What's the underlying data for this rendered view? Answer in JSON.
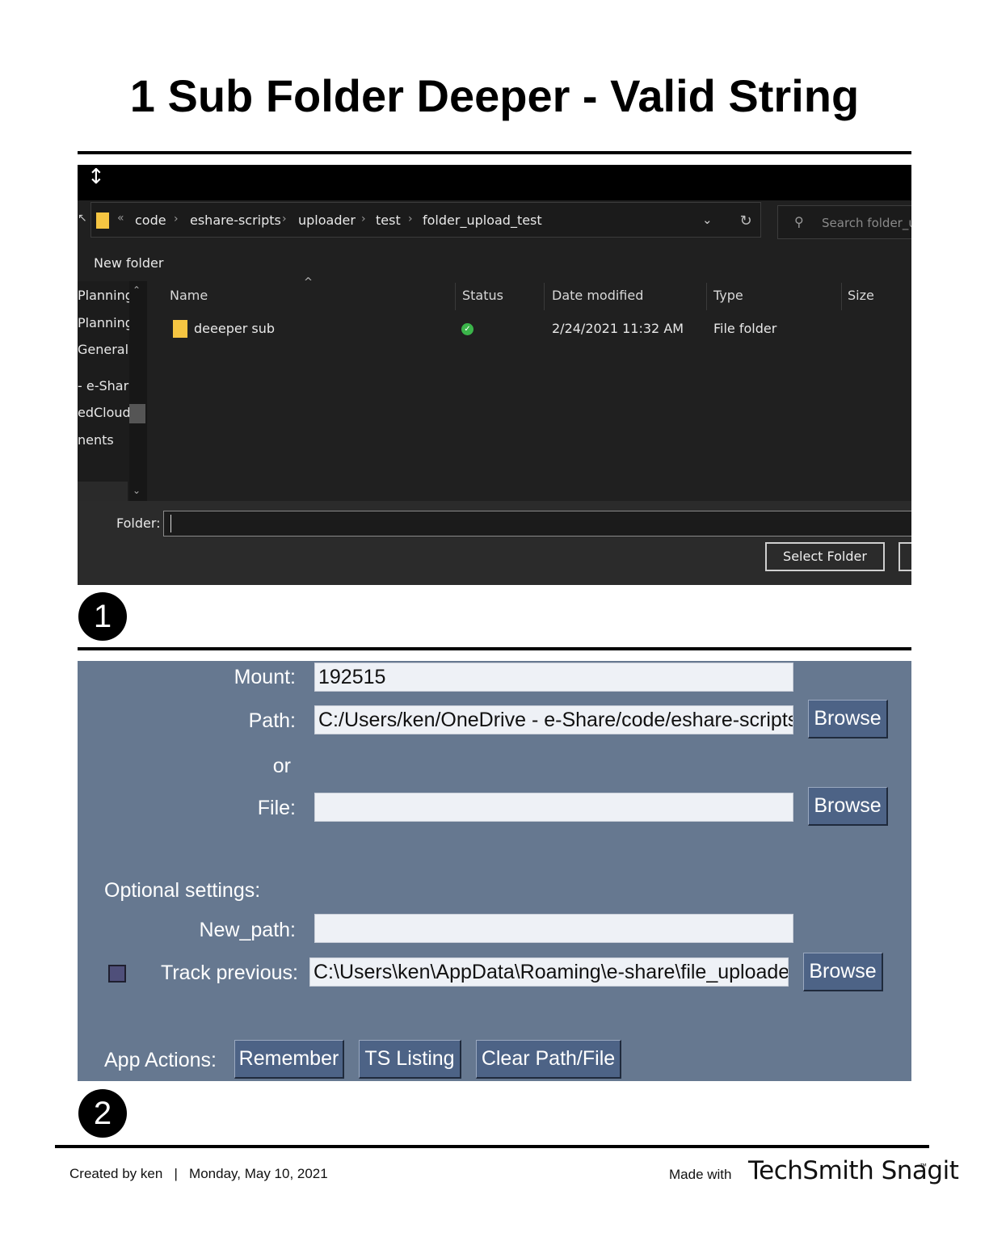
{
  "page": {
    "title": "1 Sub Folder Deeper - Valid String"
  },
  "explorer": {
    "breadcrumb": {
      "overflow": "«",
      "items": [
        "code",
        "eshare-scripts",
        "uploader",
        "test",
        "folder_upload_test"
      ],
      "separator": "›"
    },
    "search_placeholder": "Search folder_u",
    "new_folder_label": "New folder",
    "nav_items": [
      "Planning",
      "Planning",
      "General",
      "- e-Shar",
      "edCloud",
      "nents"
    ],
    "columns": [
      "Name",
      "Status",
      "Date modified",
      "Type",
      "Size"
    ],
    "rows": [
      {
        "name": "deeeper sub",
        "status": "synced",
        "date_modified": "2/24/2021 11:32 AM",
        "type": "File folder",
        "size": ""
      }
    ],
    "folder_label": "Folder:",
    "folder_value": "",
    "select_folder_label": "Select Folder",
    "colors": {
      "background": "#202020",
      "folder": "#f5c542",
      "status_ok": "#3bb54a"
    }
  },
  "badges": {
    "step1": "1",
    "step2": "2"
  },
  "uploader": {
    "mount_label": "Mount:",
    "mount_value": "192515",
    "path_label": "Path:",
    "path_value": "C:/Users/ken/OneDrive - e-Share/code/eshare-scripts/u",
    "or_label": "or",
    "file_label": "File:",
    "file_value": "",
    "browse_label": "Browse",
    "optional_label": "Optional settings:",
    "new_path_label": "New_path:",
    "new_path_value": "",
    "track_previous_label": "Track previous:",
    "track_previous_checked": false,
    "track_previous_value": "C:\\Users\\ken\\AppData\\Roaming\\e-share\\file_uploader",
    "app_actions_label": "App Actions:",
    "remember_label": "Remember",
    "ts_listing_label": "TS Listing",
    "clear_label": "Clear Path/File",
    "colors": {
      "background": "#667890",
      "button": "#4d6386",
      "field": "#eef1f6"
    }
  },
  "footer": {
    "created": "Created by ken   |   Monday, May 10, 2021",
    "made_with": "Made with",
    "brand": "TechSmith Snagit",
    "tm": "™"
  }
}
